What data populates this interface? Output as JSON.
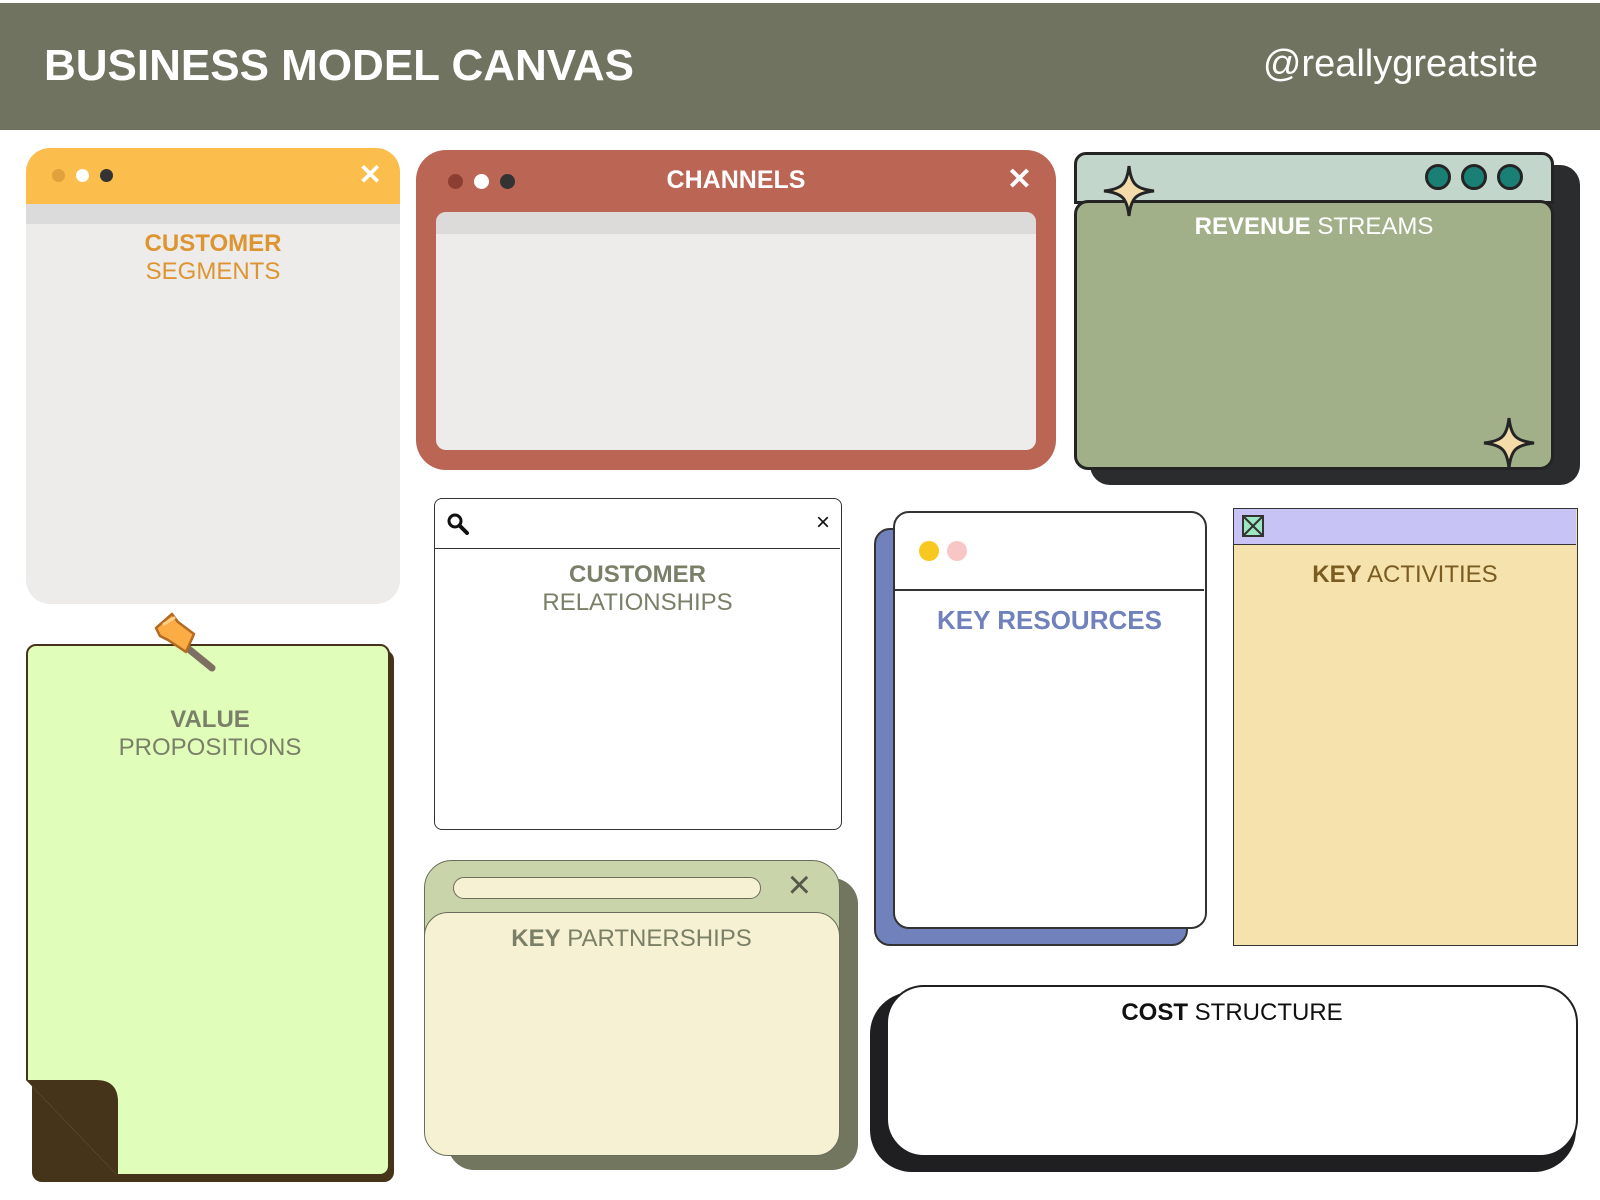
{
  "header": {
    "title": "BUSINESS MODEL CANVAS",
    "handle": "@reallygreatsite"
  },
  "customer_segments": {
    "line1": "CUSTOMER",
    "line2": "SEGMENTS",
    "close_glyph": "✕"
  },
  "channels": {
    "title": "CHANNELS",
    "close_glyph": "✕"
  },
  "revenue_streams": {
    "bold": "REVENUE",
    "rest": " STREAMS"
  },
  "value_propositions": {
    "line1": "VALUE",
    "line2": "PROPOSITIONS"
  },
  "customer_relationships": {
    "line1": "CUSTOMER",
    "line2": "RELATIONSHIPS",
    "close_glyph": "×"
  },
  "key_resources": {
    "title": "KEY RESOURCES"
  },
  "key_activities": {
    "bold": "KEY",
    "rest": " ACTIVITIES"
  },
  "key_partnerships": {
    "bold": "KEY",
    "rest": " PARTNERSHIPS",
    "close_glyph": "×"
  },
  "cost_structure": {
    "bold": "COST",
    "rest": " STRUCTURE"
  },
  "colors": {
    "header_bg": "#6f735f",
    "customer_segments_bar": "#fbbd4b",
    "channels_frame": "#bb6555",
    "revenue_body": "#a2b08a",
    "value_note": "#e0fdba",
    "key_resources_accent": "#7081bb",
    "key_activities_body": "#f5e2ad",
    "key_partnerships_body": "#f6f1d2"
  }
}
